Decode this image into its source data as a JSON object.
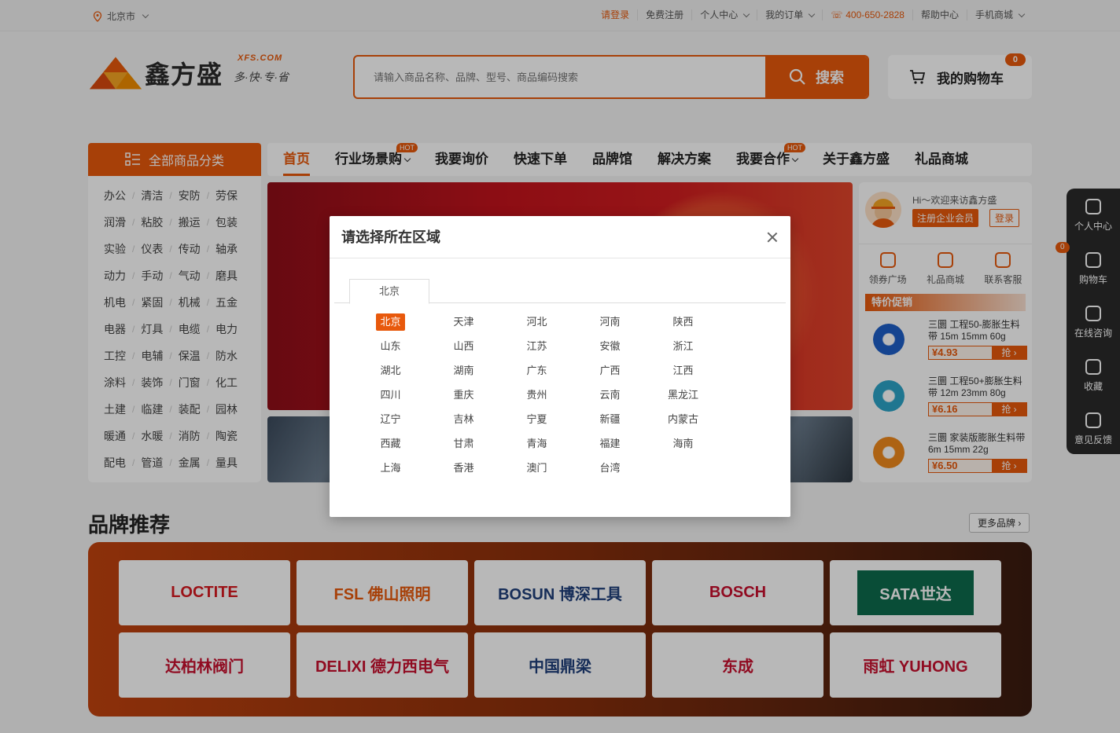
{
  "topbar": {
    "location": "北京市",
    "links": [
      {
        "label": "请登录",
        "highlight": true,
        "chevron": false
      },
      {
        "label": "免费注册",
        "highlight": false,
        "chevron": false
      },
      {
        "label": "个人中心",
        "highlight": false,
        "chevron": true
      },
      {
        "label": "我的订单",
        "highlight": false,
        "chevron": true
      },
      {
        "label": "400-650-2828",
        "highlight": true,
        "chevron": false,
        "icon": "phone-icon"
      },
      {
        "label": "帮助中心",
        "highlight": false,
        "chevron": false
      },
      {
        "label": "手机商城",
        "highlight": false,
        "chevron": true
      }
    ]
  },
  "header": {
    "logo_text": "鑫方盛",
    "logo_domain": "XFS.COM",
    "slogan": "多·快·专·省",
    "search_placeholder": "请输入商品名称、品牌、型号、商品编码搜索",
    "search_button": "搜索",
    "cart_label": "我的购物车",
    "cart_count": "0"
  },
  "category_head": "全部商品分类",
  "categories": [
    [
      "办公",
      "清洁",
      "安防",
      "劳保"
    ],
    [
      "润滑",
      "粘胶",
      "搬运",
      "包装"
    ],
    [
      "实验",
      "仪表",
      "传动",
      "轴承"
    ],
    [
      "动力",
      "手动",
      "气动",
      "磨具"
    ],
    [
      "机电",
      "紧固",
      "机械",
      "五金"
    ],
    [
      "电器",
      "灯具",
      "电缆",
      "电力"
    ],
    [
      "工控",
      "电辅",
      "保温",
      "防水"
    ],
    [
      "涂料",
      "装饰",
      "门窗",
      "化工"
    ],
    [
      "土建",
      "临建",
      "装配",
      "园林"
    ],
    [
      "暖通",
      "水暖",
      "消防",
      "陶瓷"
    ],
    [
      "配电",
      "管道",
      "金属",
      "量具"
    ]
  ],
  "nav": [
    {
      "label": "首页",
      "active": true
    },
    {
      "label": "行业场景购",
      "hot": "HOT",
      "chevron": true
    },
    {
      "label": "我要询价"
    },
    {
      "label": "快速下单"
    },
    {
      "label": "品牌馆"
    },
    {
      "label": "解决方案"
    },
    {
      "label": "我要合作",
      "hot": "HOT",
      "chevron": true
    },
    {
      "label": "关于鑫方盛"
    },
    {
      "label": "礼品商城"
    }
  ],
  "side": {
    "greeting": "Hi～欢迎来访鑫方盛",
    "register": "注册企业会员",
    "login": "登录",
    "quick": [
      {
        "label": "领券广场",
        "icon": "coupon-icon"
      },
      {
        "label": "礼品商城",
        "icon": "gift-icon"
      },
      {
        "label": "联系客服",
        "icon": "headset-icon"
      }
    ],
    "promo_title": "特价促销",
    "promos": [
      {
        "name": "三圜 工程50-膨胀生料带 15m 15mm 60g",
        "price": "¥4.93",
        "btn": "抢 ›",
        "color": "#1e5fc8"
      },
      {
        "name": "三圜 工程50+膨胀生料带 12m 23mm 80g",
        "price": "¥6.16",
        "btn": "抢 ›",
        "color": "#2ba4c8"
      },
      {
        "name": "三圜 家装版膨胀生料带 6m 15mm 22g",
        "price": "¥6.50",
        "btn": "抢 ›",
        "color": "#f08a1c"
      }
    ]
  },
  "rightbar": [
    {
      "label": "个人中心",
      "icon": "user-icon"
    },
    {
      "label": "购物车",
      "icon": "cart-icon",
      "badge": "0"
    },
    {
      "label": "在线咨询",
      "icon": "headset-icon"
    },
    {
      "label": "收藏",
      "icon": "heart-icon"
    },
    {
      "label": "意见反馈",
      "icon": "edit-icon"
    }
  ],
  "brands": {
    "title": "品牌推荐",
    "more": "更多品牌",
    "items": [
      {
        "name": "LOCTITE",
        "color": "#d71920"
      },
      {
        "name": "FSL 佛山照明",
        "color": "#e8590c"
      },
      {
        "name": "BOSUN 博深工具",
        "color": "#1f3f7a"
      },
      {
        "name": "BOSCH",
        "color": "#c8102e"
      },
      {
        "name": "SATA世达",
        "color": "#ffffff"
      },
      {
        "name": "达柏林阀门",
        "color": "#c8102e"
      },
      {
        "name": "DELIXI 德力西电气",
        "color": "#c8102e"
      },
      {
        "name": "中国鼎梁",
        "color": "#1f3f7a"
      },
      {
        "name": "东成",
        "color": "#c8102e"
      },
      {
        "name": "雨虹 YUHONG",
        "color": "#c8102e"
      }
    ]
  },
  "modal": {
    "title": "请选择所在区域",
    "tab": "北京",
    "selected": "北京",
    "regions": [
      "北京",
      "天津",
      "河北",
      "河南",
      "陕西",
      "山东",
      "山西",
      "江苏",
      "安徽",
      "浙江",
      "湖北",
      "湖南",
      "广东",
      "广西",
      "江西",
      "四川",
      "重庆",
      "贵州",
      "云南",
      "黑龙江",
      "辽宁",
      "吉林",
      "宁夏",
      "新疆",
      "内蒙古",
      "西藏",
      "甘肃",
      "青海",
      "福建",
      "海南",
      "上海",
      "香港",
      "澳门",
      "台湾"
    ]
  },
  "colors": {
    "accent": "#e8590c",
    "dark": "#2a2a2a"
  }
}
